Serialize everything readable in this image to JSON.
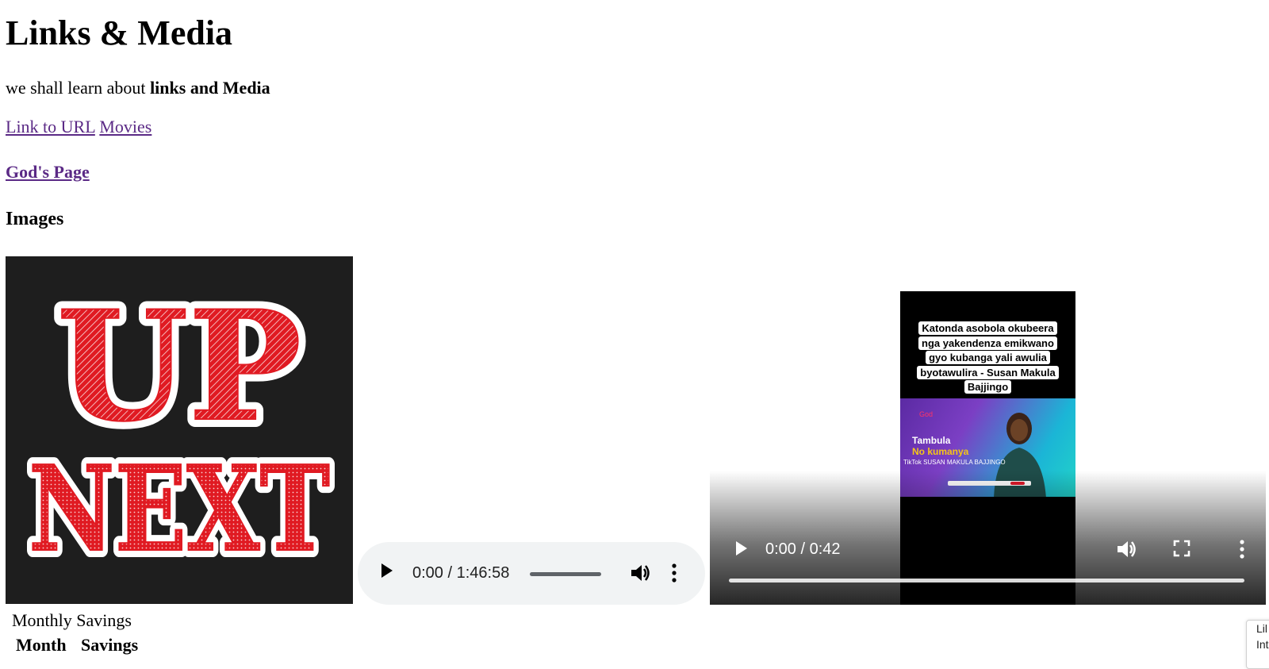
{
  "page": {
    "title": "Links & Media",
    "intro_prefix": "we shall learn about ",
    "intro_bold": "links and Media",
    "links": [
      {
        "label": "Link to URL"
      },
      {
        "label": "Movies"
      }
    ],
    "gods_page_link": "God's Page",
    "images_heading": "Images"
  },
  "image": {
    "line1": "UP",
    "line2": "NEXT",
    "colors": {
      "background": "#1e1e1e",
      "letters": "#e01a22",
      "outline": "#ffffff"
    }
  },
  "audio_player": {
    "time": "0:00 / 1:46:58",
    "icons": [
      "play-icon",
      "volume-icon",
      "more-options-icon"
    ]
  },
  "video_player": {
    "time": "0:00 / 0:42",
    "caption_lines": [
      "Katonda asobola okubeera",
      "nga yakendenza emikwano",
      "gyo kubanga yali awulia",
      "byotawulira - Susan Makula",
      "Bajjingo"
    ],
    "thumbnail": {
      "god": "God",
      "headline_1": "Tambula",
      "headline_2": "No kumanya",
      "tiktok": "TikTok",
      "tiktok_handle": "SUSAN MAKULA BAJJINGO"
    },
    "icons": [
      "play-icon",
      "volume-icon",
      "fullscreen-icon",
      "more-options-icon"
    ]
  },
  "table": {
    "caption": "Monthly Savings",
    "headers": [
      "Month",
      "Savings"
    ]
  },
  "corner_widget": {
    "lines": [
      "Lil",
      "Int"
    ]
  }
}
